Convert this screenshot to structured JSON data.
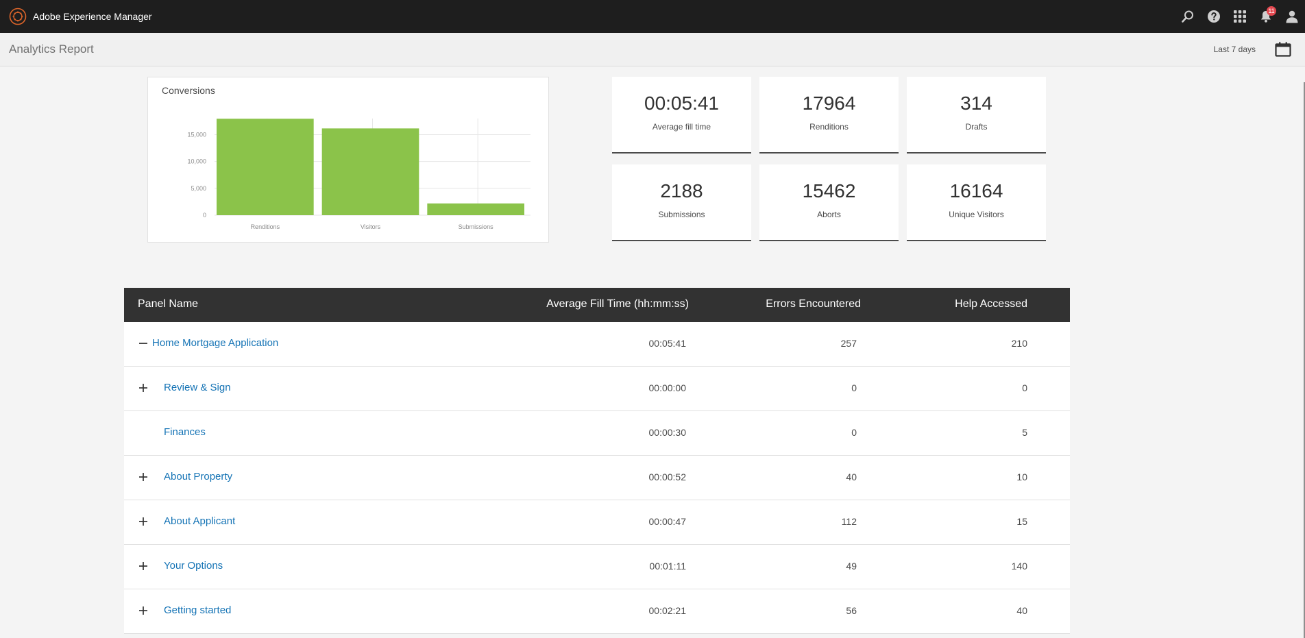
{
  "app": {
    "title": "Adobe Experience Manager",
    "notification_count": "11",
    "icons": [
      "search-icon",
      "help-icon",
      "apps-grid-icon",
      "bell-icon",
      "user-icon"
    ]
  },
  "header": {
    "page_title": "Analytics Report",
    "date_range": "Last 7 days"
  },
  "chart_data": {
    "type": "bar",
    "title": "Conversions",
    "categories": [
      "Renditions",
      "Visitors",
      "Submissions"
    ],
    "values": [
      17964,
      16164,
      2188
    ],
    "ylim": [
      0,
      18000
    ],
    "yticks": [
      0,
      5000,
      10000,
      15000
    ],
    "ytick_labels": [
      "0",
      "5,000",
      "10,000",
      "15,000"
    ],
    "xlabel": "",
    "ylabel": "",
    "grid": true,
    "bar_color": "#8bc34a"
  },
  "stats": [
    {
      "value": "00:05:41",
      "label": "Average fill time"
    },
    {
      "value": "17964",
      "label": "Renditions"
    },
    {
      "value": "314",
      "label": "Drafts"
    },
    {
      "value": "2188",
      "label": "Submissions"
    },
    {
      "value": "15462",
      "label": "Aborts"
    },
    {
      "value": "16164",
      "label": "Unique Visitors"
    }
  ],
  "table": {
    "columns": [
      "Panel Name",
      "Average Fill Time (hh:mm:ss)",
      "Errors Encountered",
      "Help Accessed"
    ],
    "rows": [
      {
        "toggle": "collapse",
        "level": 0,
        "name": "Home Mortgage Application",
        "fill": "00:05:41",
        "errors": "257",
        "help": "210"
      },
      {
        "toggle": "expand",
        "level": 1,
        "name": "Review & Sign",
        "fill": "00:00:00",
        "errors": "0",
        "help": "0"
      },
      {
        "toggle": "none",
        "level": 1,
        "name": "Finances",
        "fill": "00:00:30",
        "errors": "0",
        "help": "5"
      },
      {
        "toggle": "expand",
        "level": 1,
        "name": "About Property",
        "fill": "00:00:52",
        "errors": "40",
        "help": "10"
      },
      {
        "toggle": "expand",
        "level": 1,
        "name": "About Applicant",
        "fill": "00:00:47",
        "errors": "112",
        "help": "15"
      },
      {
        "toggle": "expand",
        "level": 1,
        "name": "Your Options",
        "fill": "00:01:11",
        "errors": "49",
        "help": "140"
      },
      {
        "toggle": "expand",
        "level": 1,
        "name": "Getting started",
        "fill": "00:02:21",
        "errors": "56",
        "help": "40"
      }
    ]
  },
  "colors": {
    "topbar": "#1e1e1e",
    "link": "#1473b5",
    "table_header": "#323232",
    "accent_orange": "#e0662a",
    "badge": "#e34850"
  }
}
